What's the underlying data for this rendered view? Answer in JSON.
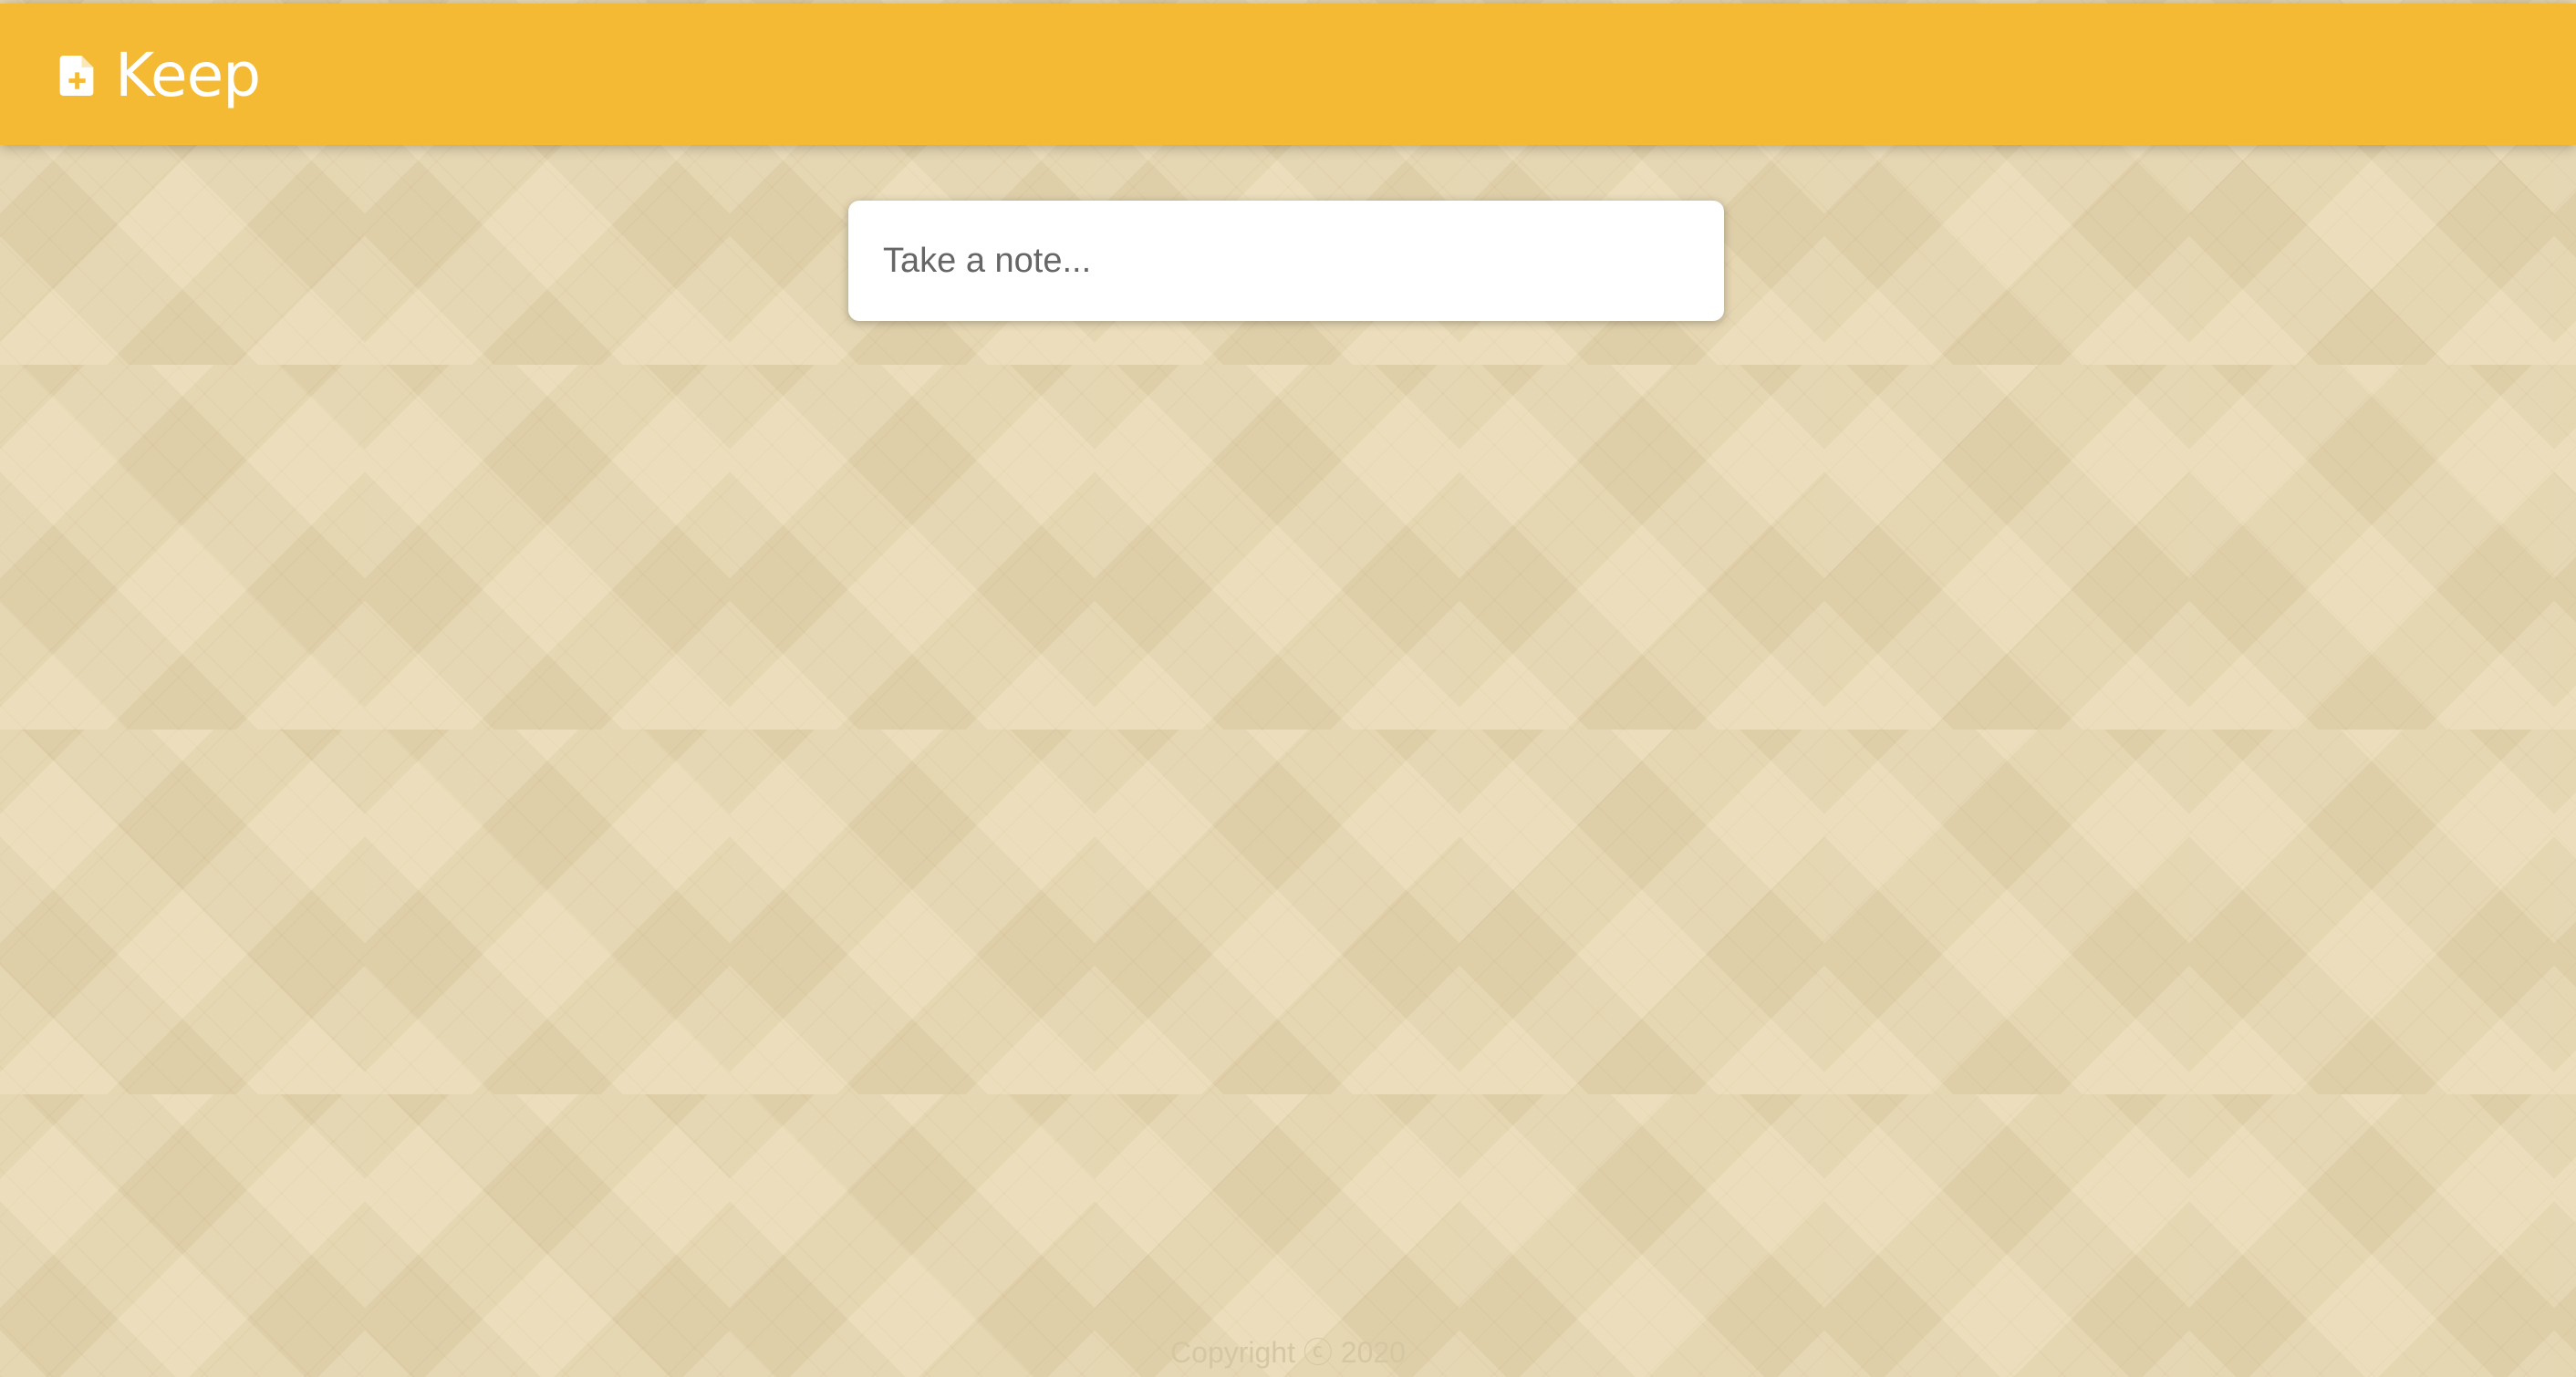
{
  "header": {
    "title": "Keep",
    "icon": "note-add-icon",
    "background_color": "#f5ba34"
  },
  "create_area": {
    "placeholder": "Take a note..."
  },
  "footer": {
    "copyright": "Copyright ⓒ 2020"
  },
  "theme": {
    "page_background": "#ead9b1",
    "footer_text_color": "#d6c7a3"
  }
}
